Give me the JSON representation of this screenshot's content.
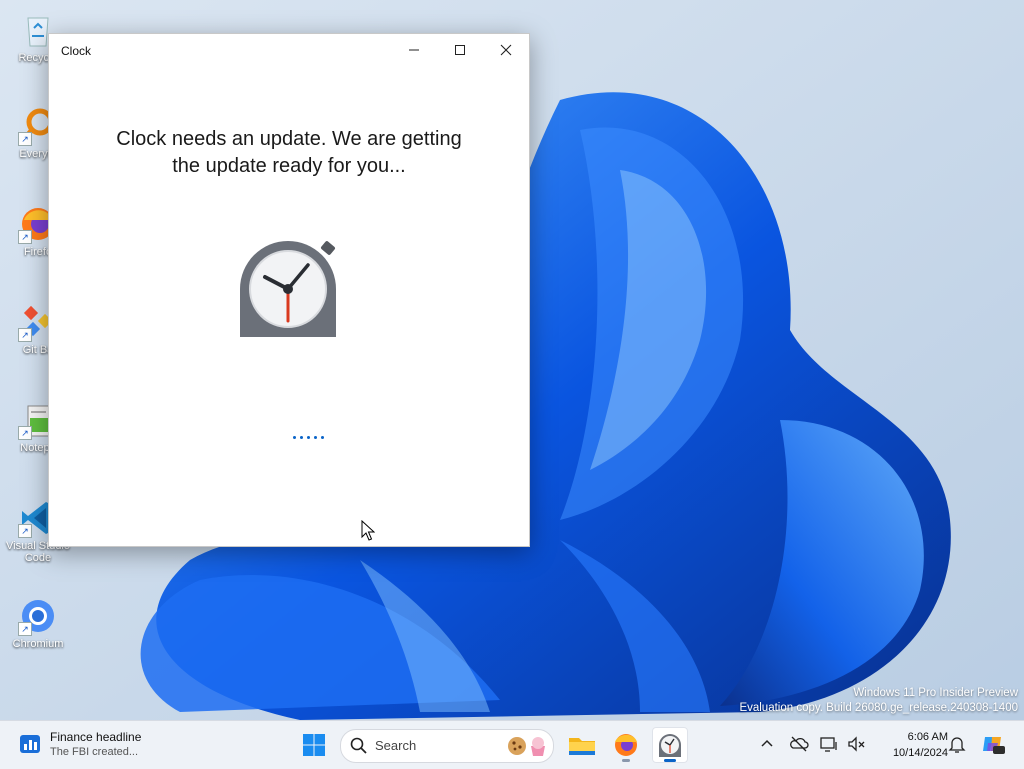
{
  "desktop": {
    "icons": [
      {
        "label": "Recycle",
        "icon": "recycle-bin-icon"
      },
      {
        "label": "Everyth",
        "icon": "everything-search-icon"
      },
      {
        "label": "Firefo",
        "icon": "firefox-icon"
      },
      {
        "label": "Git Ba",
        "icon": "git-bash-icon"
      },
      {
        "label": "Notepa",
        "icon": "notepad-icon"
      },
      {
        "label": "Visual Studio Code",
        "icon": "vscode-icon"
      },
      {
        "label": "Chromium",
        "icon": "chromium-icon"
      }
    ]
  },
  "window": {
    "title": "Clock",
    "message_line1": "Clock needs an update. We are getting",
    "message_line2": "the update ready for you...",
    "controls": {
      "minimize": "minimize-icon",
      "maximize": "maximize-icon",
      "close": "close-icon"
    }
  },
  "watermark": {
    "line1": "Windows 11 Pro Insider Preview",
    "line2": "Evaluation copy. Build 26080.ge_release.240308-1400"
  },
  "taskbar": {
    "widget": {
      "title": "Finance headline",
      "subtitle": "The FBI created..."
    },
    "search_placeholder": "Search",
    "pinned": [
      "start-icon",
      "file-explorer-icon",
      "firefox-icon",
      "clock-app-icon"
    ],
    "time": "6:06 AM",
    "date": "10/14/2024"
  },
  "colors": {
    "accent": "#0a64c8",
    "taskbar_bg": "#eef2f7"
  }
}
